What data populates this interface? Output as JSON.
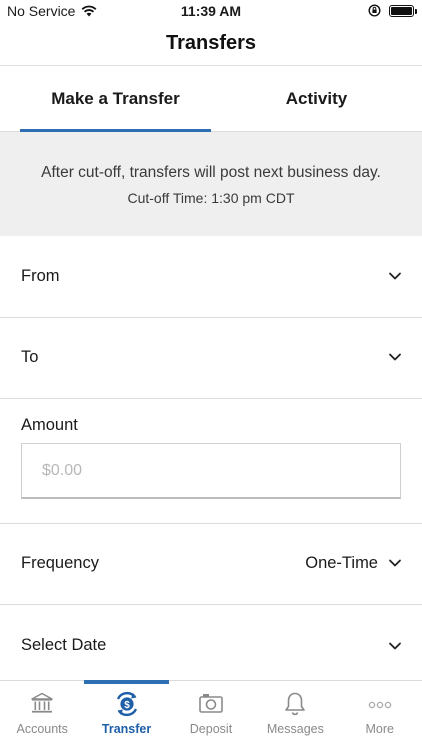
{
  "status_bar": {
    "carrier": "No Service",
    "time": "11:39 AM"
  },
  "header": {
    "title": "Transfers"
  },
  "tabs": [
    {
      "label": "Make a Transfer",
      "active": true
    },
    {
      "label": "Activity",
      "active": false
    }
  ],
  "notice": {
    "line1": "After cut-off, transfers will post next business day.",
    "line2": "Cut-off Time: 1:30 pm CDT"
  },
  "form": {
    "from_label": "From",
    "to_label": "To",
    "amount_label": "Amount",
    "amount_placeholder": "$0.00",
    "frequency_label": "Frequency",
    "frequency_value": "One-Time",
    "date_label": "Select Date"
  },
  "bottom_nav": [
    {
      "label": "Accounts",
      "icon": "bank-icon",
      "active": false
    },
    {
      "label": "Transfer",
      "icon": "transfer-dollar-icon",
      "active": true
    },
    {
      "label": "Deposit",
      "icon": "camera-icon",
      "active": false
    },
    {
      "label": "Messages",
      "icon": "bell-icon",
      "active": false
    },
    {
      "label": "More",
      "icon": "more-dots-icon",
      "active": false
    }
  ],
  "colors": {
    "accent": "#2e6fb3",
    "active_nav": "#1f5fa8",
    "notice_bg": "#efefef",
    "inactive_nav": "#8a8a8a"
  }
}
